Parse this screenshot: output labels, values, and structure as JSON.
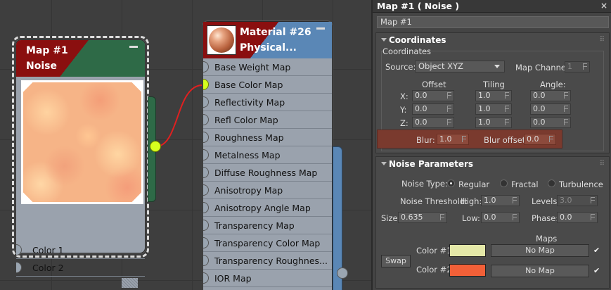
{
  "map_node": {
    "title_line1": "Map #1",
    "title_line2": "Noise",
    "inputs": [
      "Color 1",
      "Color 2"
    ]
  },
  "material_node": {
    "title_line1": "Material #26",
    "title_line2": "Physical...",
    "inputs": [
      "Base Weight Map",
      "Base Color Map",
      "Reflectivity Map",
      "Refl Color Map",
      "Roughness Map",
      "Metalness Map",
      "Diffuse Roughness Map",
      "Anisotropy Map",
      "Anisotropy Angle Map",
      "Transparency Map",
      "Transparency Color Map",
      "Transparency  Roughnes...",
      "IOR Map"
    ],
    "connected_input": "Base Color Map"
  },
  "panel": {
    "title": "Map #1  ( Noise )",
    "close": "×",
    "name_value": "Map #1",
    "coordinates": {
      "header": "Coordinates",
      "group_label": "Coordinates",
      "source_label": "Source:",
      "source_value": "Object XYZ",
      "map_channel_label": "Map Channel:",
      "map_channel_value": "1",
      "col_offset": "Offset",
      "col_tiling": "Tiling",
      "col_angle": "Angle:",
      "rows": [
        {
          "axis": "X:",
          "offset": "0.0",
          "tiling": "1.0",
          "angle": "0.0"
        },
        {
          "axis": "Y:",
          "offset": "0.0",
          "tiling": "1.0",
          "angle": "0.0"
        },
        {
          "axis": "Z:",
          "offset": "0.0",
          "tiling": "1.0",
          "angle": "0.0"
        }
      ],
      "blur_label": "Blur:",
      "blur_value": "1.0",
      "blur_offset_label": "Blur offset:",
      "blur_offset_value": "0.0"
    },
    "noise": {
      "header": "Noise Parameters",
      "type_label": "Noise Type:",
      "types": [
        "Regular",
        "Fractal",
        "Turbulence"
      ],
      "selected_type": "Regular",
      "threshold_label": "Noise Threshold:",
      "high_label": "High:",
      "high_value": "1.0",
      "levels_label": "Levels:",
      "levels_value": "3.0",
      "size_label": "Size:",
      "size_value": "0.635",
      "low_label": "Low:",
      "low_value": "0.0",
      "phase_label": "Phase:",
      "phase_value": "0.0",
      "maps_label": "Maps",
      "swap_label": "Swap",
      "color1_label": "Color #1",
      "color2_label": "Color #2",
      "color1": "#e4e8a8",
      "color2": "#f26038",
      "no_map": "No Map",
      "check": "✔"
    }
  },
  "colors": {
    "node_red": "#8a0f0f",
    "node_green": "#2e6a47",
    "node_blue": "#5a87b6",
    "port_active": "#d6ff1e",
    "wire": "#e02020"
  }
}
